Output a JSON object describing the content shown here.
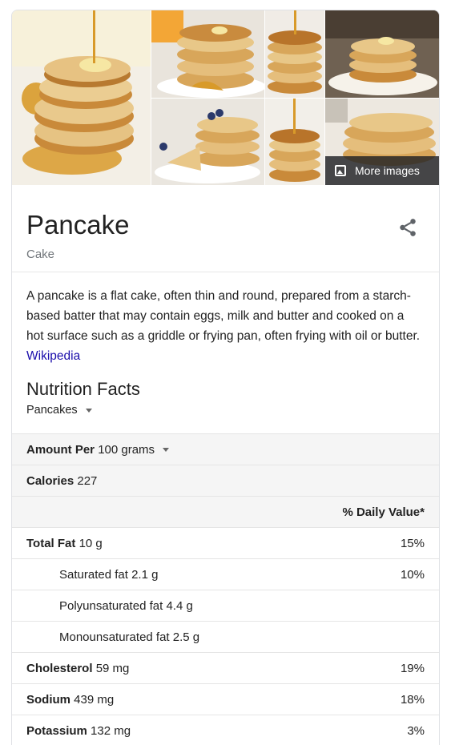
{
  "images": {
    "tiles": [
      {
        "name": "pancake-image-1"
      },
      {
        "name": "pancake-image-2"
      },
      {
        "name": "pancake-image-3"
      },
      {
        "name": "pancake-image-4"
      },
      {
        "name": "pancake-image-5"
      },
      {
        "name": "pancake-image-6"
      },
      {
        "name": "pancake-image-7"
      }
    ],
    "more_images_label": "More images",
    "more_images_icon": "image-icon"
  },
  "header": {
    "title": "Pancake",
    "subtitle": "Cake",
    "share_icon": "share-icon"
  },
  "description": {
    "text": "A pancake is a flat cake, often thin and round, prepared from a starch-based batter that may contain eggs, milk and butter and cooked on a hot surface such as a griddle or frying pan, often frying with oil or butter.",
    "source_link": "Wikipedia"
  },
  "nutrition": {
    "title": "Nutrition Facts",
    "food_select": "Pancakes",
    "amount_label": "Amount Per",
    "amount_value": "100 grams",
    "calories_label": "Calories",
    "calories_value": "227",
    "daily_value_header": "% Daily Value*",
    "rows": [
      {
        "label": "Total Fat",
        "value": "10 g",
        "dv": "15%"
      },
      {
        "label": "Saturated fat",
        "value": "2.1 g",
        "dv": "10%"
      },
      {
        "label": "Polyunsaturated fat",
        "value": "4.4 g",
        "dv": ""
      },
      {
        "label": "Monounsaturated fat",
        "value": "2.5 g",
        "dv": ""
      },
      {
        "label": "Cholesterol",
        "value": "59 mg",
        "dv": "19%"
      },
      {
        "label": "Sodium",
        "value": "439 mg",
        "dv": "18%"
      },
      {
        "label": "Potassium",
        "value": "132 mg",
        "dv": "3%"
      }
    ]
  },
  "colors": {
    "link": "#1a0dab",
    "muted": "#70757a",
    "syrup": "#d89a2a",
    "pancake": "#e2b56a"
  }
}
